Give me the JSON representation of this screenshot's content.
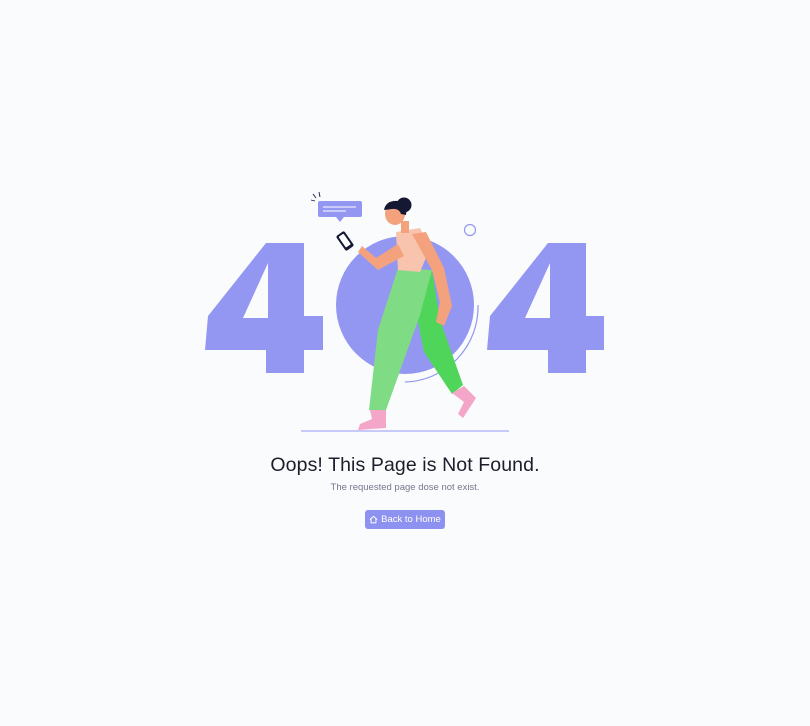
{
  "error_code": "404",
  "message": {
    "title": "Oops! This Page is Not Found.",
    "subtitle": "The requested page dose not exist."
  },
  "home_button": {
    "label": "Back to Home",
    "icon": "home-icon"
  },
  "colors": {
    "accent": "#8d91ef",
    "background": "#fafbfd",
    "title_text": "#1d1d2b",
    "subtitle_text": "#74788d",
    "pants_light": "#7fdb84",
    "pants_dark": "#4fd65a",
    "skin": "#f4a27e",
    "shoes": "#f4a6c8"
  }
}
